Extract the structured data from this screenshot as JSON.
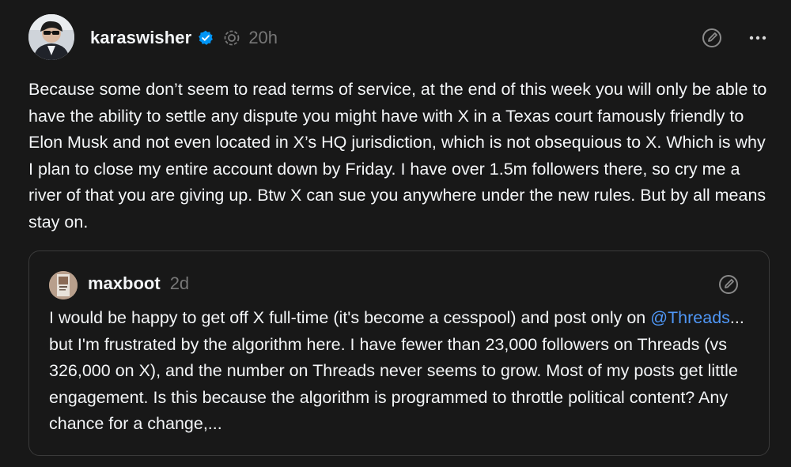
{
  "post": {
    "username": "karaswisher",
    "timestamp": "20h",
    "body": "Because some don’t seem to read terms of service, at the end of this week you will only be able to have the ability to settle any dispute you might have with X in a Texas court famously friendly to Elon Musk and not even located in X’s HQ jurisdiction, which is not obsequious to X. Which is why I plan to close my entire account down by Friday. I have over 1.5m followers there, so cry me a river of that you are giving up. Btw X can sue you anywhere under the new rules. But by all means stay on.",
    "icons": {
      "verified": "verified-badge-icon",
      "ai_label": "ai-label-icon",
      "edit": "edit-icon",
      "more": "more-icon"
    }
  },
  "quote": {
    "username": "maxboot",
    "timestamp": "2d",
    "text_before": "I would be happy to get off X full-time (it's become a cesspool) and post only on ",
    "mention": "@Threads",
    "text_after": "... but I'm frustrated by the algorithm here. I have fewer than 23,000 followers on Threads (vs 326,000 on X), and the number on Threads never seems to grow. Most of my posts get little engagement. Is this because the algorithm is programmed to throttle political content? Any chance for a change,...",
    "icons": {
      "edit": "edit-icon"
    }
  },
  "colors": {
    "background": "#181818",
    "text": "#f3f5f7",
    "muted": "#777777",
    "link": "#4f97f7",
    "verified": "#0095f6",
    "border": "#3a3a3a"
  }
}
